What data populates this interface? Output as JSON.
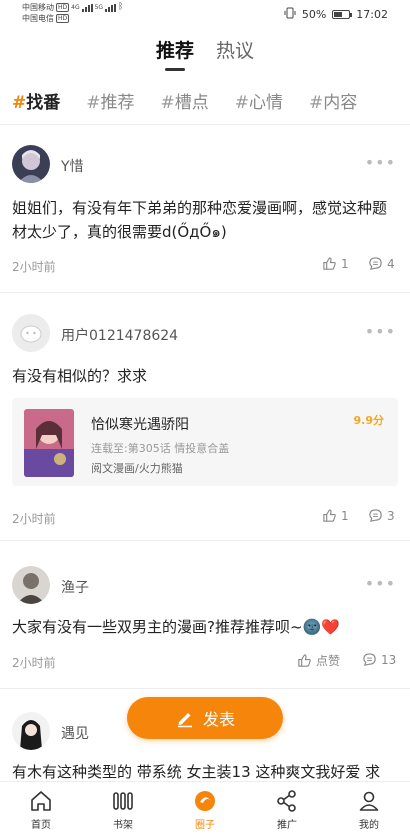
{
  "status_bar": {
    "carrier1": "中国移动",
    "carrier2": "中国电信",
    "hd": "HD",
    "net1": "4G",
    "net2": "5G",
    "battery": "50%",
    "time": "17:02"
  },
  "top_tabs": [
    {
      "label": "推荐",
      "active": true
    },
    {
      "label": "热议",
      "active": false
    }
  ],
  "topics": [
    {
      "label": "找番",
      "active": true
    },
    {
      "label": "推荐",
      "active": false
    },
    {
      "label": "槽点",
      "active": false
    },
    {
      "label": "心情",
      "active": false
    },
    {
      "label": "内容",
      "active": false
    }
  ],
  "posts": [
    {
      "username": "Y惜",
      "content": "姐姐们，有没有年下弟弟的那种恋爱漫画啊，感觉这种题材太少了，真的很需要d(ŐдŐ๑)",
      "time": "2小时前",
      "likes": "1",
      "comments": "4"
    },
    {
      "username": "用户0121478624",
      "content": "有没有相似的？求求",
      "time": "2小时前",
      "likes": "1",
      "comments": "3",
      "comic": {
        "title": "恰似寒光遇骄阳",
        "score": "9.9分",
        "sub": "连载至:第305话 情投意合盖",
        "meta": "阅文漫画/火力熊猫"
      }
    },
    {
      "username": "渔子",
      "content": "大家有没有一些双男主的漫画?推荐推荐呗~🌚❤️",
      "time": "2小时前",
      "likes": "点赞",
      "comments": "13"
    },
    {
      "username": "遇见",
      "content": "有木有这种类型的 带系统 女主装13 这种爽文我好爱 求"
    }
  ],
  "publish_label": "发表",
  "bottom_nav": [
    {
      "label": "首页",
      "icon": "home-icon",
      "active": false
    },
    {
      "label": "书架",
      "icon": "bookshelf-icon",
      "active": false
    },
    {
      "label": "圈子",
      "icon": "circle-icon",
      "active": true
    },
    {
      "label": "推广",
      "icon": "share-icon",
      "active": false
    },
    {
      "label": "我的",
      "icon": "profile-icon",
      "active": false
    }
  ],
  "colors": {
    "accent": "#f5860b",
    "score": "#f5a623",
    "card_bg": "#f6f6f6"
  }
}
